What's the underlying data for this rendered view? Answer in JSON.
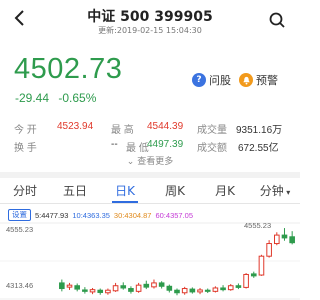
{
  "header": {
    "title": "中证 500 399905",
    "update_time": "更新:2019-02-15 15:04:30"
  },
  "quote": {
    "price": "4502.73",
    "change": "-29.44",
    "change_pct": "-0.65%"
  },
  "actions": [
    {
      "label": "问股",
      "icon": "question-icon"
    },
    {
      "label": "预警",
      "icon": "bell-icon"
    }
  ],
  "stats": {
    "open_label": "今 开",
    "open": "4523.94",
    "high_label": "最 高",
    "high": "4544.39",
    "volume_label": "成交量",
    "volume": "9351.16万",
    "turnover_label": "换 手",
    "turnover": "--",
    "low_label": "最 低",
    "low": "4497.39",
    "amount_label": "成交额",
    "amount": "672.55亿"
  },
  "more_label": "查看更多",
  "tabs": [
    "分时",
    "五日",
    "日K",
    "周K",
    "月K",
    "分钟"
  ],
  "active_tab": "日K",
  "ma": {
    "settings": "设置",
    "ma5": "5:4477.93",
    "ma10": "10:4363.35",
    "ma30": "30:4304.87",
    "ma60": "60:4357.05"
  },
  "chart_data": {
    "type": "candlestick",
    "y_top_label": "4555.23",
    "y_bottom_label": "4313.46",
    "max_marker": "4555.23",
    "candles": [
      {
        "o": 4360,
        "c": 4340,
        "h": 4372,
        "l": 4330
      },
      {
        "o": 4345,
        "c": 4352,
        "h": 4360,
        "l": 4335
      },
      {
        "o": 4350,
        "c": 4338,
        "h": 4358,
        "l": 4330
      },
      {
        "o": 4335,
        "c": 4330,
        "h": 4345,
        "l": 4322
      },
      {
        "o": 4328,
        "c": 4336,
        "h": 4342,
        "l": 4320
      },
      {
        "o": 4334,
        "c": 4326,
        "h": 4340,
        "l": 4318
      },
      {
        "o": 4325,
        "c": 4334,
        "h": 4340,
        "l": 4318
      },
      {
        "o": 4332,
        "c": 4350,
        "h": 4360,
        "l": 4328
      },
      {
        "o": 4350,
        "c": 4342,
        "h": 4362,
        "l": 4336
      },
      {
        "o": 4340,
        "c": 4330,
        "h": 4348,
        "l": 4322
      },
      {
        "o": 4330,
        "c": 4352,
        "h": 4360,
        "l": 4325
      },
      {
        "o": 4355,
        "c": 4345,
        "h": 4368,
        "l": 4338
      },
      {
        "o": 4346,
        "c": 4360,
        "h": 4372,
        "l": 4340
      },
      {
        "o": 4360,
        "c": 4348,
        "h": 4366,
        "l": 4340
      },
      {
        "o": 4348,
        "c": 4334,
        "h": 4354,
        "l": 4326
      },
      {
        "o": 4334,
        "c": 4325,
        "h": 4340,
        "l": 4316
      },
      {
        "o": 4325,
        "c": 4340,
        "h": 4346,
        "l": 4318
      },
      {
        "o": 4338,
        "c": 4328,
        "h": 4344,
        "l": 4322
      },
      {
        "o": 4328,
        "c": 4335,
        "h": 4342,
        "l": 4320
      },
      {
        "o": 4334,
        "c": 4330,
        "h": 4340,
        "l": 4324
      },
      {
        "o": 4330,
        "c": 4342,
        "h": 4348,
        "l": 4326
      },
      {
        "o": 4342,
        "c": 4336,
        "h": 4352,
        "l": 4330
      },
      {
        "o": 4336,
        "c": 4350,
        "h": 4356,
        "l": 4332
      },
      {
        "o": 4350,
        "c": 4344,
        "h": 4358,
        "l": 4338
      },
      {
        "o": 4344,
        "c": 4390,
        "h": 4395,
        "l": 4340
      },
      {
        "o": 4392,
        "c": 4385,
        "h": 4400,
        "l": 4378
      },
      {
        "o": 4388,
        "c": 4455,
        "h": 4460,
        "l": 4385
      },
      {
        "o": 4455,
        "c": 4500,
        "h": 4512,
        "l": 4450
      },
      {
        "o": 4500,
        "c": 4530,
        "h": 4540,
        "l": 4494
      },
      {
        "o": 4530,
        "c": 4520,
        "h": 4555,
        "l": 4510
      },
      {
        "o": 4524,
        "c": 4503,
        "h": 4544,
        "l": 4497
      }
    ]
  },
  "colors": {
    "up": "#e0392b",
    "down": "#2e9b4d",
    "accent": "#2f6cdf",
    "ma5": "#333333",
    "ma10": "#2f6cdf",
    "ma30": "#e08a1c",
    "ma60": "#c43ad6"
  }
}
